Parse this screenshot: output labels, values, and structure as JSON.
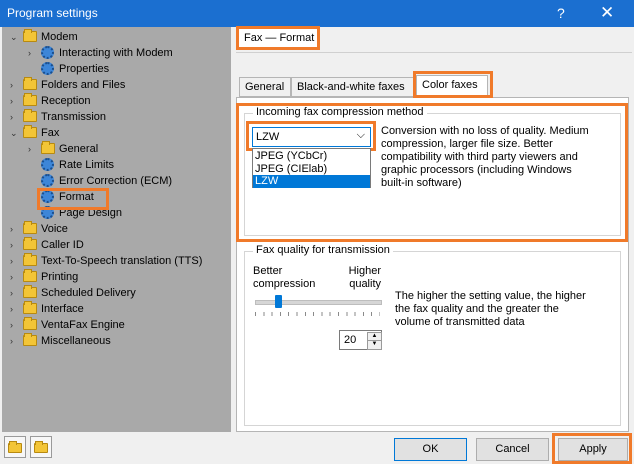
{
  "window": {
    "title": "Program settings",
    "help_glyph": "?",
    "close_glyph": "✕"
  },
  "tree": [
    {
      "label": "Modem",
      "icon": "folder-icon",
      "expanded": true
    },
    {
      "label": "Interacting with Modem",
      "icon": "gear-icon"
    },
    {
      "label": "Properties",
      "icon": "gear-icon"
    },
    {
      "label": "Folders and Files",
      "icon": "folder-icon"
    },
    {
      "label": "Reception",
      "icon": "folder-icon"
    },
    {
      "label": "Transmission",
      "icon": "folder-icon"
    },
    {
      "label": "Fax",
      "icon": "folder-icon",
      "expanded": true
    },
    {
      "label": "General",
      "icon": "folder-icon"
    },
    {
      "label": "Rate Limits",
      "icon": "gear-icon"
    },
    {
      "label": "Error Correction (ECM)",
      "icon": "gear-icon"
    },
    {
      "label": "Format",
      "icon": "gear-icon",
      "selected": true
    },
    {
      "label": "Page Design",
      "icon": "gear-icon"
    },
    {
      "label": "Voice",
      "icon": "folder-icon"
    },
    {
      "label": "Caller ID",
      "icon": "folder-icon"
    },
    {
      "label": "Text-To-Speech translation (TTS)",
      "icon": "folder-icon"
    },
    {
      "label": "Printing",
      "icon": "folder-icon"
    },
    {
      "label": "Scheduled Delivery",
      "icon": "folder-icon"
    },
    {
      "label": "Interface",
      "icon": "folder-icon"
    },
    {
      "label": "VentaFax Engine",
      "icon": "folder-icon"
    },
    {
      "label": "Miscellaneous",
      "icon": "folder-icon"
    }
  ],
  "breadcrumb": "Fax — Format",
  "tabs": [
    {
      "label": "General"
    },
    {
      "label": "Black-and-white faxes"
    },
    {
      "label": "Color faxes",
      "active": true
    }
  ],
  "compression": {
    "legend": "Incoming fax compression method",
    "selected": "LZW",
    "options": [
      "JPEG (YCbCr)",
      "JPEG (CIElab)",
      "LZW"
    ],
    "description": [
      "Conversion with no loss of quality. Medium",
      "compression, larger file size. Better",
      "compatibility with third party viewers and",
      "graphic processors (including Windows",
      "built-in software)"
    ]
  },
  "quality": {
    "legend": "Fax quality for transmission",
    "left_label": [
      "Better",
      "compression"
    ],
    "right_label": [
      "Higher",
      "quality"
    ],
    "slider_fraction": 0.18,
    "value": "20",
    "description": [
      "The higher the setting value, the higher",
      "the fax quality and the greater the",
      "volume of transmitted data"
    ]
  },
  "buttons": {
    "ok": "OK",
    "cancel": "Cancel",
    "apply": "Apply"
  }
}
